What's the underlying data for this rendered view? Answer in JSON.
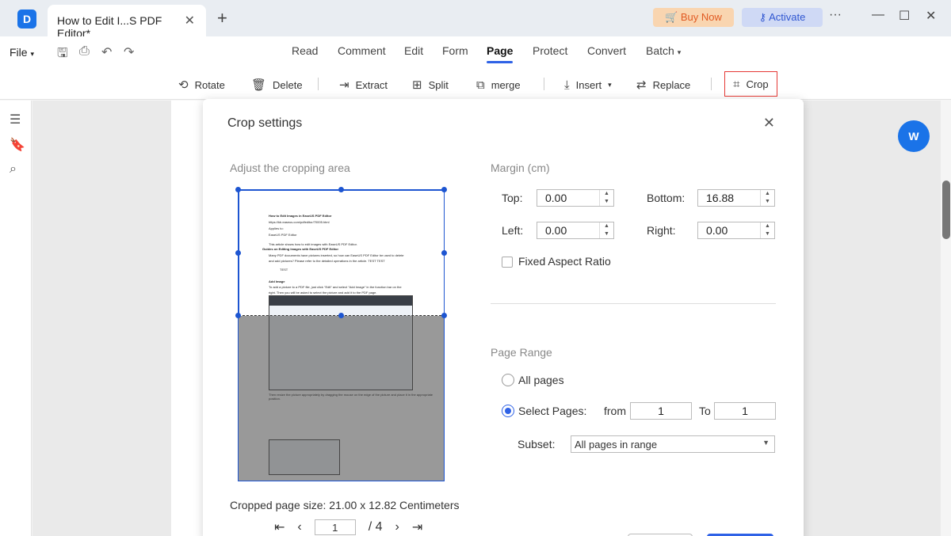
{
  "titlebar": {
    "tab_title": "How to Edit I...S PDF Editor*",
    "buy_label": "Buy Now",
    "activate_label": "Activate",
    "accent_buy": "#e15a22",
    "accent_activate": "#2f56d1"
  },
  "menubar": {
    "file_label": "File",
    "items": [
      "Read",
      "Comment",
      "Edit",
      "Form",
      "Page",
      "Protect",
      "Convert",
      "Batch"
    ],
    "active": "Page"
  },
  "toolbar": {
    "rotate": "Rotate",
    "delete": "Delete",
    "extract": "Extract",
    "split": "Split",
    "merge": "merge",
    "insert": "Insert",
    "replace": "Replace",
    "crop": "Crop"
  },
  "dialog": {
    "title": "Crop settings",
    "adjust_title": "Adjust the cropping area",
    "margin_title": "Margin (cm)",
    "top_label": "Top:",
    "top_value": "0.00",
    "bottom_label": "Bottom:",
    "bottom_value": "16.88",
    "left_label": "Left:",
    "left_value": "0.00",
    "right_label": "Right:",
    "right_value": "0.00",
    "fixed_aspect_label": "Fixed Aspect Ratio",
    "page_range_title": "Page Range",
    "all_pages_label": "All pages",
    "select_pages_label": "Select Pages:",
    "from_label": "from",
    "from_value": "1",
    "to_label": "To",
    "to_value": "1",
    "subset_label": "Subset:",
    "subset_value": "All pages in range",
    "cropped_size": "Cropped page size: 21.00 x 12.82 Centimeters",
    "current_page": "1",
    "total_pages": "/ 4"
  },
  "preview_doc": {
    "lines": [
      "How to Edit Images in EaseUS PDF Editor",
      "https://kb.easeus.com/pdfeditor/70005.html",
      "Applies to:",
      "EaseUS PDF Editor",
      "This article shows how to edit images with EaseUS PDF Editor.",
      "Guides on Editing Images with EaseUS PDF Editor",
      "Many PDF documents have pictures inserted, so how can EaseUS PDF Editor be used to delete",
      "and add pictures? Please refer to the detailed operations in the article. TEST TEST",
      "TEST",
      "Add Image",
      "To add a picture to a PDF file, just click \"Edit\" and select \"Add Image\" in the function bar on the",
      "right. Then you will be asked to select the picture and add it to the PDF page."
    ],
    "footer_line": "Then resize the picture appropriately by dragging the mouse on the edge of the picture and place it in the appropriate position."
  },
  "fab": {
    "label": "W"
  }
}
